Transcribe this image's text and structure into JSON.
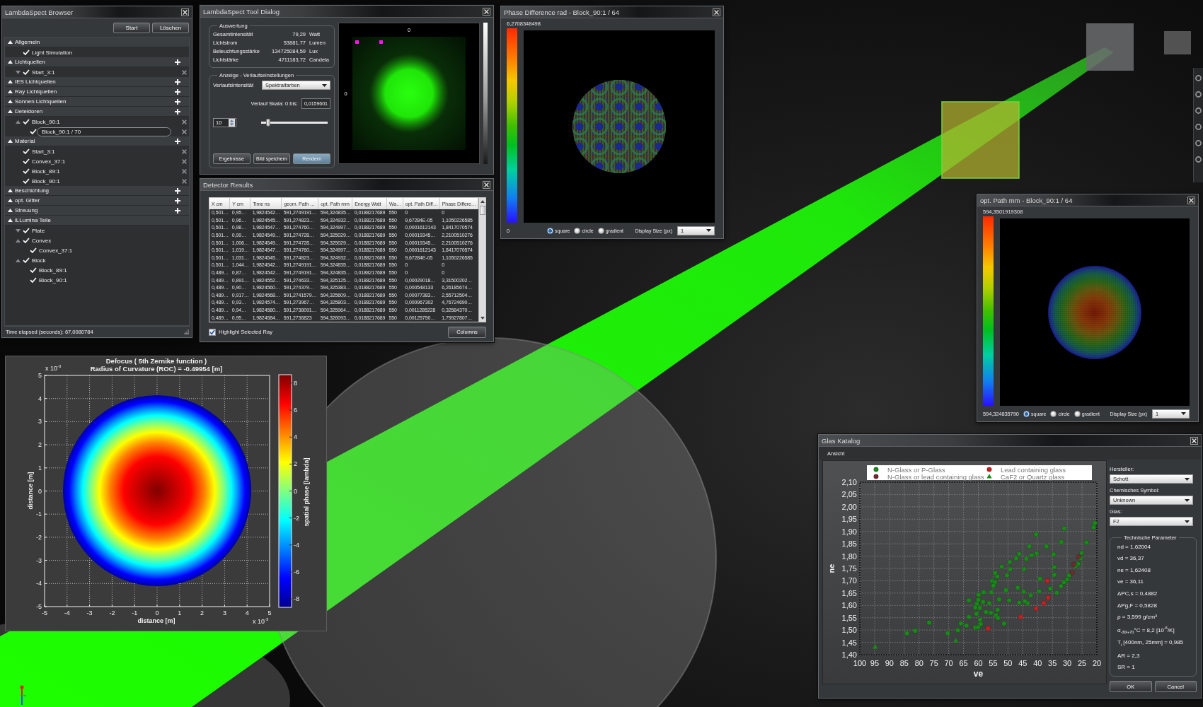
{
  "browser": {
    "title": "LambdaSpect Browser",
    "buttons": [
      "Start",
      "Löschen"
    ],
    "sections": [
      {
        "label": "Allgemein",
        "expanded": true,
        "addable": false,
        "children": [
          {
            "label": "Light Simulation",
            "checked": true,
            "removable": false,
            "selected": false
          }
        ]
      },
      {
        "label": "Lichtquellen",
        "expanded": true,
        "addable": true,
        "children": [
          {
            "label": "Start_3:1",
            "expanded": false,
            "checked": true,
            "removable": true,
            "selected": false
          }
        ]
      },
      {
        "label": "IES Lichtquellen",
        "expanded": true,
        "addable": true
      },
      {
        "label": "Ray Lichtquellen",
        "expanded": true,
        "addable": true
      },
      {
        "label": "Sonnen Lichtquellen",
        "expanded": true,
        "addable": true
      },
      {
        "label": "Detektoren",
        "expanded": true,
        "addable": true,
        "children": [
          {
            "label": "Block_90:1",
            "expanded": true,
            "checked": true,
            "removable": true,
            "selected": false,
            "children": [
              {
                "label": "Block_90:1 / 70",
                "checked": true,
                "removable": true,
                "selected": true
              }
            ]
          }
        ]
      },
      {
        "label": "Material",
        "expanded": true,
        "addable": true,
        "children": [
          {
            "label": "Start_3:1",
            "checked": true,
            "removable": true,
            "selected": false
          },
          {
            "label": "Convex_37:1",
            "checked": true,
            "removable": true,
            "selected": false
          },
          {
            "label": "Block_89:1",
            "checked": true,
            "removable": true,
            "selected": false
          },
          {
            "label": "Block_90:1",
            "checked": true,
            "removable": true,
            "selected": false
          }
        ]
      },
      {
        "label": "Beschichtung",
        "expanded": true,
        "addable": true
      },
      {
        "label": "opt. Gitter",
        "expanded": true,
        "addable": true
      },
      {
        "label": "Streuung",
        "expanded": true,
        "addable": true
      },
      {
        "label": "iLLumina Teile",
        "expanded": true,
        "addable": false,
        "children": [
          {
            "label": "Plate",
            "expanded": false,
            "checked": true,
            "removable": false,
            "selected": false
          },
          {
            "label": "Convex",
            "expanded": true,
            "checked": true,
            "removable": false,
            "selected": false,
            "children": [
              {
                "label": "Convex_37:1",
                "checked": true,
                "removable": false,
                "selected": false
              }
            ]
          },
          {
            "label": "Block",
            "expanded": true,
            "checked": true,
            "removable": false,
            "selected": false,
            "children": [
              {
                "label": "Block_89:1",
                "checked": true,
                "removable": false,
                "selected": false
              },
              {
                "label": "Block_90:1",
                "checked": true,
                "removable": false,
                "selected": false
              }
            ]
          }
        ]
      }
    ],
    "status": "Time elapsed (seconds): 67,0080784"
  },
  "tool_dialog": {
    "title": "LambdaSpect Tool Dialog",
    "evaluation": {
      "title": "Auswertung",
      "rows": [
        {
          "label": "Gesamtintensität",
          "value": "79,29",
          "unit": "Watt"
        },
        {
          "label": "Lichtstrom",
          "value": "53881,77",
          "unit": "Lumen"
        },
        {
          "label": "Beleuchtungsstärke",
          "value": "134725084,59",
          "unit": "Lux"
        },
        {
          "label": "Lichtstärke",
          "value": "4711183,72",
          "unit": "Candela"
        }
      ]
    },
    "display": {
      "title": "Anzeige - Verlaufseinstellungen",
      "gradient_label": "Verlaufsintensität",
      "gradient_value": "Spektralfarben",
      "scale_label": "Verlauf Skala: 0 bis:",
      "scale_value": "0,0159601",
      "spin_value": "10",
      "slider": {
        "level": 0.11
      }
    },
    "buttons": [
      {
        "label": "Ergebnisse",
        "default": false
      },
      {
        "label": "Bild speichern",
        "default": false
      },
      {
        "label": "Rendern",
        "default": true
      }
    ],
    "preview": {
      "top_label": "0",
      "left_label": "0"
    }
  },
  "detector_results": {
    "title": "Detector Results",
    "columns": [
      "X cm",
      "Y cm",
      "Time ns",
      "geom. Path …",
      "opt. Path mm",
      "Energy Watt",
      "Wa…",
      "opt. Path Diff…",
      "Phase Differe…"
    ],
    "rows": [
      [
        "0,501…",
        "0,95…",
        "1,9824542…",
        "591,2749191…",
        "594,324835…",
        "0,0188217689",
        "550",
        "0",
        "0"
      ],
      [
        "0,501…",
        "0,96…",
        "1,9824545…",
        "591,274823…",
        "594,324932…",
        "0,0188217689",
        "550",
        "9,67284E-05",
        "1,1050226585"
      ],
      [
        "0,501…",
        "0,98…",
        "1,9824547…",
        "591,274760…",
        "594,324997…",
        "0,0188217689",
        "550",
        "0,0001612143",
        "1,8417070574"
      ],
      [
        "0,501…",
        "0,99…",
        "1,9824549…",
        "591,274728…",
        "594,325029…",
        "0,0188217689",
        "550",
        "0,00019345…",
        "2,2100510276"
      ],
      [
        "0,501…",
        "1,006…",
        "1,9824549…",
        "591,274728…",
        "594,325029…",
        "0,0188217689",
        "550",
        "0,00019345…",
        "2,2100510276"
      ],
      [
        "0,501…",
        "1,019…",
        "1,9824547…",
        "591,274760…",
        "594,324997…",
        "0,0188217689",
        "550",
        "0,0001612143",
        "1,8417070574"
      ],
      [
        "0,501…",
        "1,031…",
        "1,9824545…",
        "591,274823…",
        "594,324932…",
        "0,0188217689",
        "550",
        "9,67284E-05",
        "1,1050226585"
      ],
      [
        "0,501…",
        "1,044…",
        "1,9824542…",
        "591,2749191…",
        "594,324835…",
        "0,0188217689",
        "550",
        "0",
        "0"
      ],
      [
        "0,489…",
        "0,87…",
        "1,9824542…",
        "591,2749191…",
        "594,324835…",
        "0,0188217689",
        "550",
        "0",
        "0"
      ],
      [
        "0,489…",
        "0,891…",
        "1,9824552…",
        "591,274633…",
        "594,325125…",
        "0,0188217689",
        "550",
        "0,00029018…",
        "3,31500202…"
      ],
      [
        "0,489…",
        "0,90…",
        "1,9824560…",
        "591,274379…",
        "594,325383…",
        "0,0188217689",
        "550",
        "0,000548133",
        "6,26185674…"
      ],
      [
        "0,489…",
        "0,917…",
        "1,9824568…",
        "591,2741579…",
        "594,325609…",
        "0,0188217689",
        "550",
        "0,00077383…",
        "2,55712504…"
      ],
      [
        "0,489…",
        "0,93…",
        "1,9824574…",
        "591,273967…",
        "594,325803…",
        "0,0188217689",
        "550",
        "0,000967302",
        "4,76724690…"
      ],
      [
        "0,489…",
        "0,94…",
        "1,9824580…",
        "591,2738091…",
        "594,325964…",
        "0,0188217689",
        "550",
        "0,0011285228",
        "0,32584370…"
      ],
      [
        "0,489…",
        "0,95…",
        "1,9824584…",
        "591,2736823",
        "594,326093…",
        "0,0188217689",
        "550",
        "0,00125750…",
        "1,79927807…"
      ]
    ],
    "highlight": {
      "label": "Highlight Selected Ray",
      "checked": true
    },
    "columns_button": "Columns"
  },
  "map_windows": [
    {
      "kind": "phase",
      "title": "Phase Difference rad - Block_90:1 / 64",
      "scale_max": "6,2708348498",
      "scale_min": "0",
      "shapes": [
        {
          "label": "square",
          "selected": true
        },
        {
          "label": "circle",
          "selected": false
        },
        {
          "label": "gradient",
          "selected": false
        }
      ],
      "size_label": "Display Size (px)",
      "size_value": "1"
    },
    {
      "kind": "path",
      "title": "opt. Path mm - Block_90:1 / 64",
      "scale_max": "594,3501919308",
      "scale_min": "594,324835790",
      "shapes": [
        {
          "label": "square",
          "selected": true
        },
        {
          "label": "circle",
          "selected": false
        },
        {
          "label": "gradient",
          "selected": false
        }
      ],
      "size_label": "Display Size (px)",
      "size_value": "1"
    }
  ],
  "defocus_plot": {
    "title_lines": [
      "Defocus ( 5th Zernike function )",
      "Radius of Curvature (ROC) = -0.49954 [m]"
    ],
    "xlabel": "distance [m]",
    "ylabel": "distance [m]",
    "xticks": [
      "-5",
      "-4",
      "-3",
      "-2",
      "-1",
      "0",
      "1",
      "2",
      "3",
      "4",
      "5"
    ],
    "yticks": [
      "5",
      "4",
      "3",
      "2",
      "1",
      "0",
      "-1",
      "-2",
      "-3",
      "-4",
      "-5"
    ],
    "exponent_labels": [
      "x 10$^{-3}$",
      "x 10$^{-3}$"
    ],
    "colorbar": {
      "label": "spatial phase [lambda]",
      "ticks": [
        "8",
        "6",
        "4",
        "2",
        "0",
        "-2",
        "-4",
        "-6",
        "-8"
      ]
    }
  },
  "glass_catalog": {
    "title": "Glas Katalog",
    "menu": [
      "Ansicht"
    ],
    "chart_data": {
      "type": "scatter",
      "xlabel": "ve",
      "ylabel": "ne",
      "grid": true,
      "legend": "top",
      "xlim": [
        100,
        20
      ],
      "ylim": [
        1.4,
        2.1
      ],
      "xticks": [
        {
          "value": 100,
          "label": "100"
        },
        {
          "value": 95,
          "label": "95"
        },
        {
          "value": 90,
          "label": "90"
        },
        {
          "value": 85,
          "label": "85"
        },
        {
          "value": 80,
          "label": "80"
        },
        {
          "value": 75,
          "label": "75"
        },
        {
          "value": 70,
          "label": "70"
        },
        {
          "value": 65,
          "label": "65"
        },
        {
          "value": 60,
          "label": "60"
        },
        {
          "value": 55,
          "label": "55"
        },
        {
          "value": 50,
          "label": "50"
        },
        {
          "value": 45,
          "label": "45"
        },
        {
          "value": 40,
          "label": "40"
        },
        {
          "value": 35,
          "label": "35"
        },
        {
          "value": 30,
          "label": "30"
        },
        {
          "value": 25,
          "label": "25"
        },
        {
          "value": 20,
          "label": "20"
        }
      ],
      "yticks": [
        {
          "value": 1.4,
          "label": "1,40"
        },
        {
          "value": 1.45,
          "label": "1,45"
        },
        {
          "value": 1.5,
          "label": "1,50"
        },
        {
          "value": 1.55,
          "label": "1,55"
        },
        {
          "value": 1.6,
          "label": "1,60"
        },
        {
          "value": 1.65,
          "label": "1,65"
        },
        {
          "value": 1.7,
          "label": "1,70"
        },
        {
          "value": 1.75,
          "label": "1,75"
        },
        {
          "value": 1.8,
          "label": "1,80"
        },
        {
          "value": 1.85,
          "label": "1,85"
        },
        {
          "value": 1.9,
          "label": "1,90"
        },
        {
          "value": 1.95,
          "label": "1,95"
        },
        {
          "value": 2.0,
          "label": "2,00"
        },
        {
          "value": 2.05,
          "label": "2,05"
        },
        {
          "value": 2.1,
          "label": "2,10"
        }
      ],
      "series": [
        {
          "name": "N-Glass or P-Glass",
          "color": "#178a17",
          "marker": "circle",
          "x": [
            20.7,
            21.1,
            31.0,
            40.5,
            32.0,
            23.5,
            42.8,
            37.0,
            46.2,
            40.3,
            42.0,
            34.6,
            25.1,
            47.2,
            43.8,
            25.5,
            49.4,
            26.3,
            52.1,
            49.2,
            44.6,
            34.4,
            27.2,
            54.3,
            53.6,
            34.4,
            29.4,
            50.3,
            55.3,
            54.4,
            30.0,
            39.2,
            31.1,
            54.9,
            32.1,
            46.7,
            50.7,
            58.2,
            55.6,
            44.7,
            35.7,
            33.5,
            59.9,
            39.5,
            42.3,
            63.2,
            60.0,
            53.0,
            49.6,
            58.4,
            56.3,
            60.5,
            46.2,
            43.4,
            44.3,
            61.0,
            59.5,
            57.4,
            55.8,
            53.5,
            60.6,
            54.0,
            53.4,
            63.2,
            59.4,
            59.2,
            51.3,
            65.9,
            64.0,
            76.6,
            61.0,
            60.1,
            66.9,
            81.3,
            84.1,
            70.3
          ],
          "values": [
            1.934,
            1.917,
            1.912,
            1.888,
            1.857,
            1.855,
            1.84,
            1.84,
            1.809,
            1.811,
            1.804,
            1.807,
            1.813,
            1.791,
            1.789,
            1.791,
            1.776,
            1.768,
            1.757,
            1.747,
            1.747,
            1.755,
            1.76,
            1.731,
            1.717,
            1.724,
            1.722,
            1.722,
            1.699,
            1.694,
            1.705,
            1.708,
            1.694,
            1.68,
            1.678,
            1.672,
            1.662,
            1.653,
            1.653,
            1.655,
            1.668,
            1.651,
            1.643,
            1.657,
            1.641,
            1.62,
            1.622,
            1.624,
            1.62,
            1.614,
            1.609,
            1.606,
            1.611,
            1.609,
            1.617,
            1.591,
            1.589,
            1.573,
            1.57,
            1.582,
            1.566,
            1.56,
            1.549,
            1.553,
            1.542,
            1.524,
            1.526,
            1.527,
            1.518,
            1.53,
            1.51,
            1.511,
            1.499,
            1.497,
            1.487,
            1.487
          ]
        },
        {
          "name": "Lead containing glass",
          "color": "#c42020",
          "marker": "circle",
          "x": [
            56.7,
            45.7,
            40.5,
            37.9,
            36.4,
            36.7
          ],
          "values": [
            1.506,
            1.553,
            1.587,
            1.609,
            1.631,
            1.7
          ]
        },
        {
          "name": "N-Glass or lead containing glass",
          "color": "#6e2c2c",
          "marker": "circle",
          "x": [
            28.3,
            26.2,
            27.8
          ],
          "values": [
            1.733,
            1.797,
            1.766
          ]
        },
        {
          "name": "CaF2 or Quartz glass",
          "color": "#178a17",
          "marker": "triangle",
          "x": [
            94.8,
            67.6
          ],
          "values": [
            1.432,
            1.457
          ]
        }
      ]
    },
    "filters": [
      {
        "label": "Hersteller:",
        "value": "Schott"
      },
      {
        "label": "Chemisches Symbol:",
        "value": "Unknown"
      },
      {
        "label": "Glas:",
        "value": "F2"
      }
    ],
    "parameters": {
      "title": "Technische Parameter",
      "lines": [
        "nd = 1,62004",
        "vd = 36,37",
        "ne = 1,62408",
        "ve = 36,11",
        "ΔPC,s = 0,4882",
        "ΔPg,F = 0,5828",
        "ρ = 3,599 g/cm³",
        "α$_{-30/+70}$°C = 8,2 [10$^{-6}$/K]",
        "T$_{i}$ [400nm, 25mm] = 0,985",
        "AR = 2,3",
        "SR = 1"
      ]
    },
    "buttons": [
      "OK",
      "Cancel"
    ]
  }
}
